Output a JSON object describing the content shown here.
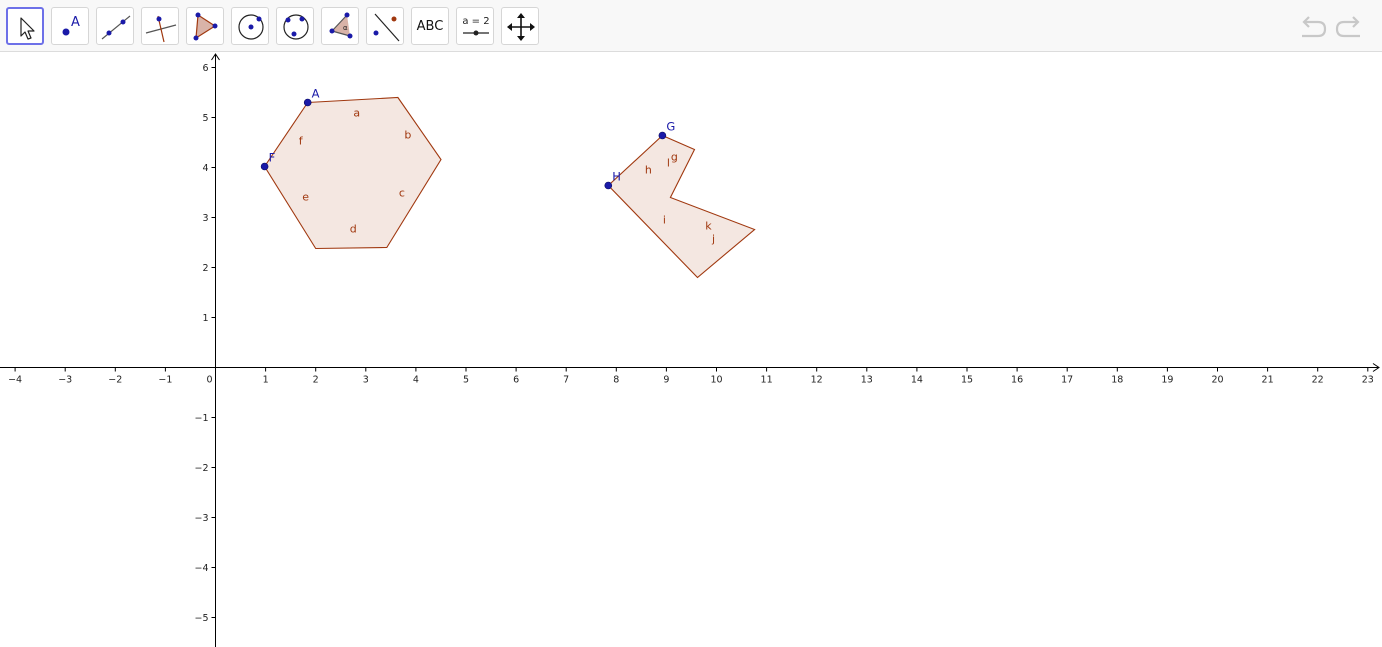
{
  "toolbar": {
    "tools": [
      {
        "name": "move-tool",
        "icon": "cursor-arrow-icon",
        "active": true
      },
      {
        "name": "point-tool",
        "icon": "point-icon",
        "label": "A"
      },
      {
        "name": "line-tool",
        "icon": "line-through-points-icon"
      },
      {
        "name": "perpendicular-line-tool",
        "icon": "perpendicular-line-icon"
      },
      {
        "name": "polygon-tool",
        "icon": "polygon-icon"
      },
      {
        "name": "circle-center-point-tool",
        "icon": "circle-center-icon"
      },
      {
        "name": "circle-three-points-tool",
        "icon": "circle-three-points-icon"
      },
      {
        "name": "angle-tool",
        "icon": "angle-icon",
        "label": "α"
      },
      {
        "name": "reflect-tool",
        "icon": "reflect-about-line-icon"
      },
      {
        "name": "text-tool",
        "icon": "text-icon",
        "label": "ABC"
      },
      {
        "name": "slider-tool",
        "icon": "slider-icon",
        "label": "a = 2"
      },
      {
        "name": "move-graphics-view-tool",
        "icon": "move-arrows-icon"
      }
    ],
    "undo_icon": "undo-icon",
    "redo_icon": "redo-icon"
  },
  "colors": {
    "point": "#1a1aa8",
    "segment": "#a0380f",
    "fill": "#f3e4de",
    "axis": "#000000",
    "accent": "#6d70e8"
  },
  "axes": {
    "x_ticks": [
      "−4",
      "−3",
      "−2",
      "−1",
      "0",
      "1",
      "2",
      "3",
      "4",
      "5",
      "6",
      "7",
      "8",
      "9",
      "10",
      "11",
      "12",
      "13",
      "14",
      "15",
      "16",
      "17",
      "18",
      "19",
      "20",
      "21",
      "22",
      "23"
    ],
    "x_values": [
      -4,
      -3,
      -2,
      -1,
      0,
      1,
      2,
      3,
      4,
      5,
      6,
      7,
      8,
      9,
      10,
      11,
      12,
      13,
      14,
      15,
      16,
      17,
      18,
      19,
      20,
      21,
      22,
      23
    ],
    "y_ticks": [
      "6",
      "5",
      "4",
      "3",
      "2",
      "1",
      "−1",
      "−2",
      "−3",
      "−4",
      "−5"
    ],
    "y_values": [
      6,
      5,
      4,
      3,
      2,
      1,
      -1,
      -2,
      -3,
      -4,
      -5
    ]
  },
  "polygons": [
    {
      "name": "hexagon",
      "vertices": [
        [
          1.84,
          5.3
        ],
        [
          3.64,
          5.4
        ],
        [
          4.5,
          4.16
        ],
        [
          3.42,
          2.4
        ],
        [
          2.0,
          2.38
        ],
        [
          0.98,
          4.02
        ]
      ],
      "segment_labels": [
        {
          "text": "a",
          "x": 2.82,
          "y": 5.1
        },
        {
          "text": "b",
          "x": 3.84,
          "y": 4.66
        },
        {
          "text": "c",
          "x": 3.72,
          "y": 3.5
        },
        {
          "text": "d",
          "x": 2.75,
          "y": 2.78
        },
        {
          "text": "e",
          "x": 1.8,
          "y": 3.42
        },
        {
          "text": "f",
          "x": 1.7,
          "y": 4.54
        }
      ]
    },
    {
      "name": "concave-polygon",
      "vertices": [
        [
          8.92,
          4.64
        ],
        [
          9.56,
          4.36
        ],
        [
          9.08,
          3.4
        ],
        [
          10.76,
          2.76
        ],
        [
          9.62,
          1.8
        ],
        [
          7.84,
          3.64
        ]
      ],
      "segment_labels": [
        {
          "text": "g",
          "x": 9.16,
          "y": 4.22
        },
        {
          "text": "l",
          "x": 9.04,
          "y": 4.1
        },
        {
          "text": "k",
          "x": 9.84,
          "y": 2.84
        },
        {
          "text": "j",
          "x": 9.94,
          "y": 2.58
        },
        {
          "text": "i",
          "x": 8.96,
          "y": 2.96
        },
        {
          "text": "h",
          "x": 8.64,
          "y": 3.96
        }
      ]
    }
  ],
  "points": [
    {
      "label": "A",
      "x": 1.84,
      "y": 5.3
    },
    {
      "label": "F",
      "x": 0.98,
      "y": 4.02
    },
    {
      "label": "G",
      "x": 8.92,
      "y": 4.64
    },
    {
      "label": "H",
      "x": 7.84,
      "y": 3.64
    }
  ]
}
